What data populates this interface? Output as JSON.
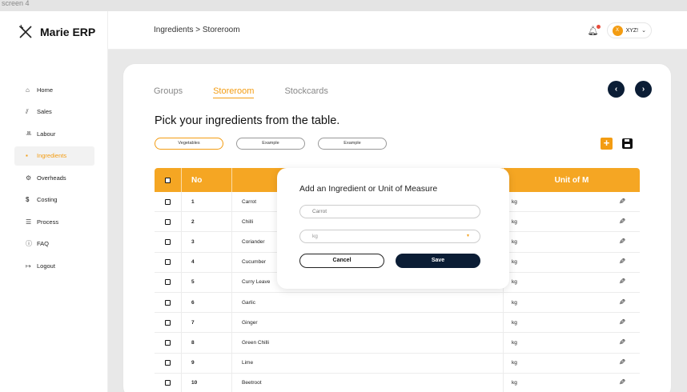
{
  "top_strip": "screen 4",
  "app": {
    "name": "Marie ERP",
    "logo_icon": "fork-knife-icon"
  },
  "sidebar": {
    "items": [
      {
        "label": "Home",
        "icon": "home-icon"
      },
      {
        "label": "Sales",
        "icon": "sales-icon"
      },
      {
        "label": "Labour",
        "icon": "people-icon"
      },
      {
        "label": "Ingredients",
        "icon": "ingredients-icon",
        "active": true
      },
      {
        "label": "Overheads",
        "icon": "gear-icon"
      },
      {
        "label": "Costing",
        "icon": "dollar-icon"
      },
      {
        "label": "Process",
        "icon": "process-icon"
      },
      {
        "label": "FAQ",
        "icon": "question-icon"
      },
      {
        "label": "Logout",
        "icon": "logout-icon"
      }
    ]
  },
  "header": {
    "breadcrumb": "Ingredients > Storeroom",
    "user_initial": "X",
    "user_name": "XYZ!"
  },
  "tabs": [
    {
      "label": "Groups",
      "active": false
    },
    {
      "label": "Storeroom",
      "active": true
    },
    {
      "label": "Stockcards",
      "active": false
    }
  ],
  "main": {
    "title": "Pick your ingredients from the table.",
    "chips": [
      "Vegetables",
      "Example",
      "Example"
    ]
  },
  "table": {
    "headers": {
      "no": "No",
      "name": "",
      "unit": "Unit of M"
    },
    "rows": [
      {
        "no": "1",
        "name": "Carrot",
        "unit": "kg"
      },
      {
        "no": "2",
        "name": "Chilli",
        "unit": "kg"
      },
      {
        "no": "3",
        "name": "Coriander",
        "unit": "kg"
      },
      {
        "no": "4",
        "name": "Cucumber",
        "unit": "kg"
      },
      {
        "no": "5",
        "name": "Curry Leave",
        "unit": "kg"
      },
      {
        "no": "6",
        "name": "Garlic",
        "unit": "kg"
      },
      {
        "no": "7",
        "name": "Ginger",
        "unit": "kg"
      },
      {
        "no": "8",
        "name": "Green Chilli",
        "unit": "kg"
      },
      {
        "no": "9",
        "name": "Lime",
        "unit": "kg"
      },
      {
        "no": "10",
        "name": "Beetroot",
        "unit": "kg"
      }
    ]
  },
  "modal": {
    "title": "Add an Ingredient or Unit of Measure",
    "name_placeholder": "Carrot",
    "unit_value": "kg",
    "cancel_label": "Cancel",
    "save_label": "Save"
  },
  "colors": {
    "accent": "#f39c12",
    "navy": "#0b1d35",
    "table_header": "#f5a623"
  }
}
